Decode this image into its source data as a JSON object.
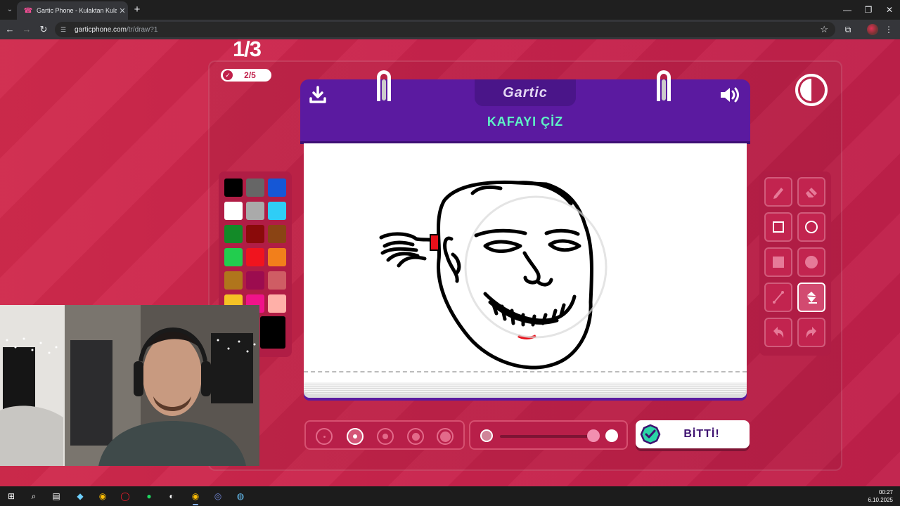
{
  "browser": {
    "tab_title": "Gartic Phone - Kulaktan Kulağa",
    "url_host": "garticphone.com",
    "url_path": "/tr/draw?1"
  },
  "game": {
    "round": "1/3",
    "progress": "2/5",
    "logo": "Gartic",
    "prompt": "KAFAYI ÇİZ",
    "done_label": "BİTTİ!",
    "palette_colors": [
      "#000000",
      "#666666",
      "#1557d6",
      "#ffffff",
      "#aaaaaa",
      "#2fcdf6",
      "#138a28",
      "#8a0a0a",
      "#8a4414",
      "#22cd4e",
      "#f0141e",
      "#f27f1b",
      "#b0751c",
      "#9c0c4f",
      "#cf5d64",
      "#f5c225",
      "#f0138a",
      "#ffb0a8"
    ],
    "selected_color": "#000000",
    "tools": [
      "pencil-icon",
      "eraser-icon",
      "rectangle-outline-icon",
      "ellipse-outline-icon",
      "rectangle-fill-icon",
      "ellipse-fill-icon",
      "line-icon",
      "fill-bucket-icon",
      "undo-icon",
      "redo-icon"
    ],
    "active_tool": "fill-bucket-icon",
    "brush_sizes": 5,
    "selected_size_index": 1
  },
  "taskbar": {
    "time": "00:27",
    "date": "6.10.2025"
  }
}
